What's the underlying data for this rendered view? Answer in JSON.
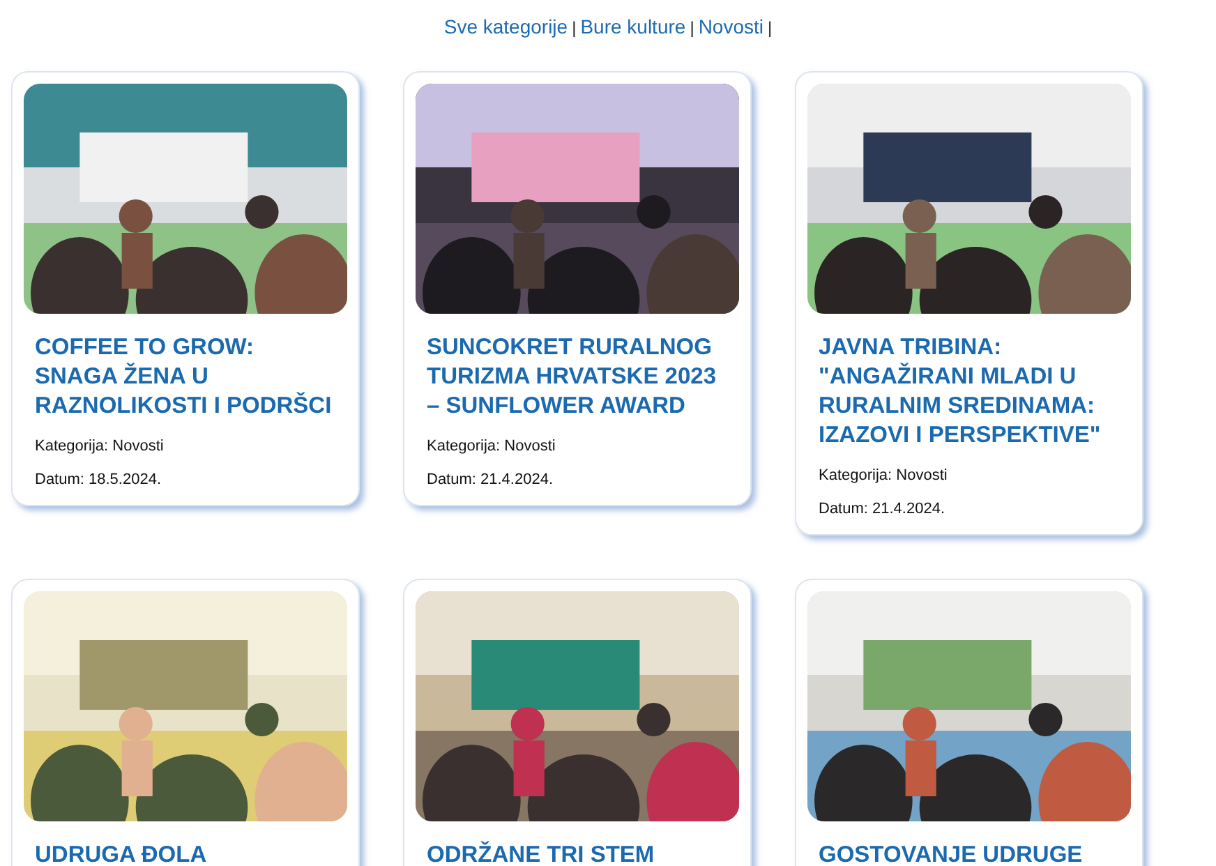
{
  "category_nav": {
    "links": [
      {
        "label": "Sve kategorije"
      },
      {
        "label": "Bure kulture"
      },
      {
        "label": "Novosti"
      }
    ],
    "separator": "|"
  },
  "posts": [
    {
      "title": "COFFEE TO GROW: SNAGA ŽENA U RAZNOLIKOSTI I PODRŠCI",
      "category": "Kategorija: Novosti",
      "date": "Datum: 18.5.2024."
    },
    {
      "title": "SUNCOKRET RURALNOG TURIZMA HRVATSKE 2023 – SUNFLOWER AWARD",
      "category": "Kategorija: Novosti",
      "date": "Datum: 21.4.2024."
    },
    {
      "title": "JAVNA TRIBINA: \"ANGAŽIRANI MLADI U RURALNIM SREDINAMA: IZAZOVI I PERSPEKTIVE\"",
      "category": "Kategorija: Novosti",
      "date": "Datum: 21.4.2024."
    },
    {
      "title": "UDRUGA ĐOLA"
    },
    {
      "title": "ODRŽANE TRI STEM"
    },
    {
      "title": "GOSTOVANJE UDRUGE"
    }
  ]
}
